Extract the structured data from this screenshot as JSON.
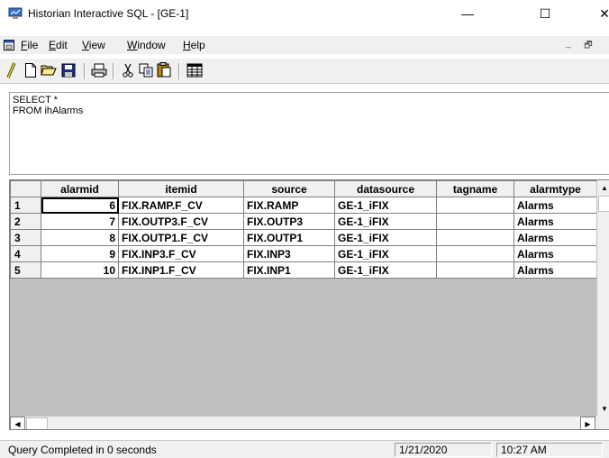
{
  "window": {
    "title": "Historian Interactive SQL - [GE-1]",
    "controls": {
      "minimize": "—",
      "maximize": "☐",
      "close": "✕"
    }
  },
  "menu": {
    "items": [
      {
        "label_underlined": "F",
        "label_rest": "ile"
      },
      {
        "label_underlined": "E",
        "label_rest": "dit"
      },
      {
        "label_underlined": "V",
        "label_rest": "iew"
      },
      {
        "label_underlined": "W",
        "label_rest": "indow"
      },
      {
        "label_underlined": "H",
        "label_rest": "elp"
      }
    ],
    "mdi_controls": {
      "minimize": "_",
      "restore": "🗗"
    }
  },
  "toolbar": {
    "buttons": [
      {
        "name": "execute-icon"
      },
      {
        "name": "new-icon"
      },
      {
        "name": "open-folder-icon"
      },
      {
        "name": "save-icon"
      },
      {
        "name": "print-icon"
      },
      {
        "name": "cut-icon"
      },
      {
        "name": "copy-icon"
      },
      {
        "name": "paste-icon"
      },
      {
        "name": "grid-icon"
      }
    ]
  },
  "sql_editor": {
    "query": "SELECT *\nFROM ihAlarms"
  },
  "grid": {
    "columns": [
      "alarmid",
      "itemid",
      "source",
      "datasource",
      "tagname",
      "alarmtype"
    ],
    "rows": [
      {
        "rownum": "1",
        "alarmid": "6",
        "itemid": "FIX.RAMP.F_CV",
        "source": "FIX.RAMP",
        "datasource": "GE-1_iFIX",
        "tagname": "",
        "alarmtype": "Alarms"
      },
      {
        "rownum": "2",
        "alarmid": "7",
        "itemid": "FIX.OUTP3.F_CV",
        "source": "FIX.OUTP3",
        "datasource": "GE-1_iFIX",
        "tagname": "",
        "alarmtype": "Alarms"
      },
      {
        "rownum": "3",
        "alarmid": "8",
        "itemid": "FIX.OUTP1.F_CV",
        "source": "FIX.OUTP1",
        "datasource": "GE-1_iFIX",
        "tagname": "",
        "alarmtype": "Alarms"
      },
      {
        "rownum": "4",
        "alarmid": "9",
        "itemid": "FIX.INP3.F_CV",
        "source": "FIX.INP3",
        "datasource": "GE-1_iFIX",
        "tagname": "",
        "alarmtype": "Alarms"
      },
      {
        "rownum": "5",
        "alarmid": "10",
        "itemid": "FIX.INP1.F_CV",
        "source": "FIX.INP1",
        "datasource": "GE-1_iFIX",
        "tagname": "",
        "alarmtype": "Alarms"
      }
    ]
  },
  "status": {
    "message": "Query Completed in  0 seconds",
    "date": "1/21/2020",
    "time": "10:27 AM"
  }
}
